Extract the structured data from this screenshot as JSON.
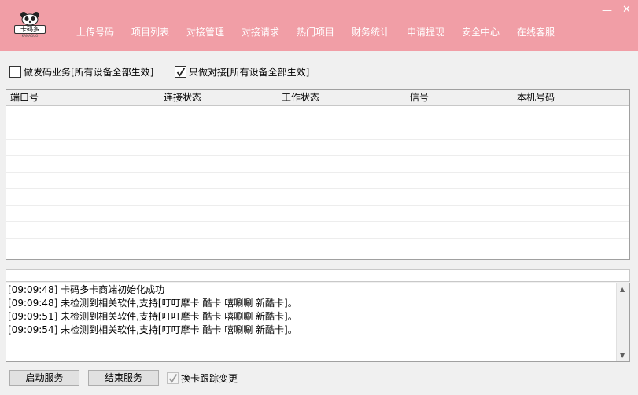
{
  "header": {
    "logo_text": "卡码多",
    "logo_sub": "KAMADUO",
    "nav": [
      "上传号码",
      "项目列表",
      "对接管理",
      "对接请求",
      "热门项目",
      "财务统计",
      "申请提现",
      "安全中心",
      "在线客服"
    ],
    "minimize_glyph": "—",
    "close_glyph": "✕"
  },
  "options": {
    "send_code": {
      "label": "做发码业务[所有设备全部生效]",
      "checked": false
    },
    "only_dock": {
      "label": "只做对接[所有设备全部生效]",
      "checked": true
    }
  },
  "table": {
    "columns": [
      "端口号",
      "连接状态",
      "工作状态",
      "信号",
      "本机号码"
    ]
  },
  "log": {
    "lines": [
      "[09:09:48] 卡码多卡商端初始化成功",
      "[09:09:48] 未检测到相关软件,支持[叮叮摩卡 酷卡 嘻唰唰 新酷卡]。",
      "[09:09:51] 未检测到相关软件,支持[叮叮摩卡 酷卡 嘻唰唰 新酷卡]。",
      "[09:09:54] 未检测到相关软件,支持[叮叮摩卡 酷卡 嘻唰唰 新酷卡]。"
    ]
  },
  "controls": {
    "start_label": "启动服务",
    "stop_label": "结束服务",
    "track_label": "换卡跟踪变更",
    "track_checked": true
  },
  "colors": {
    "header_bg": "#f19ea6",
    "header_text": "#ffffff"
  }
}
